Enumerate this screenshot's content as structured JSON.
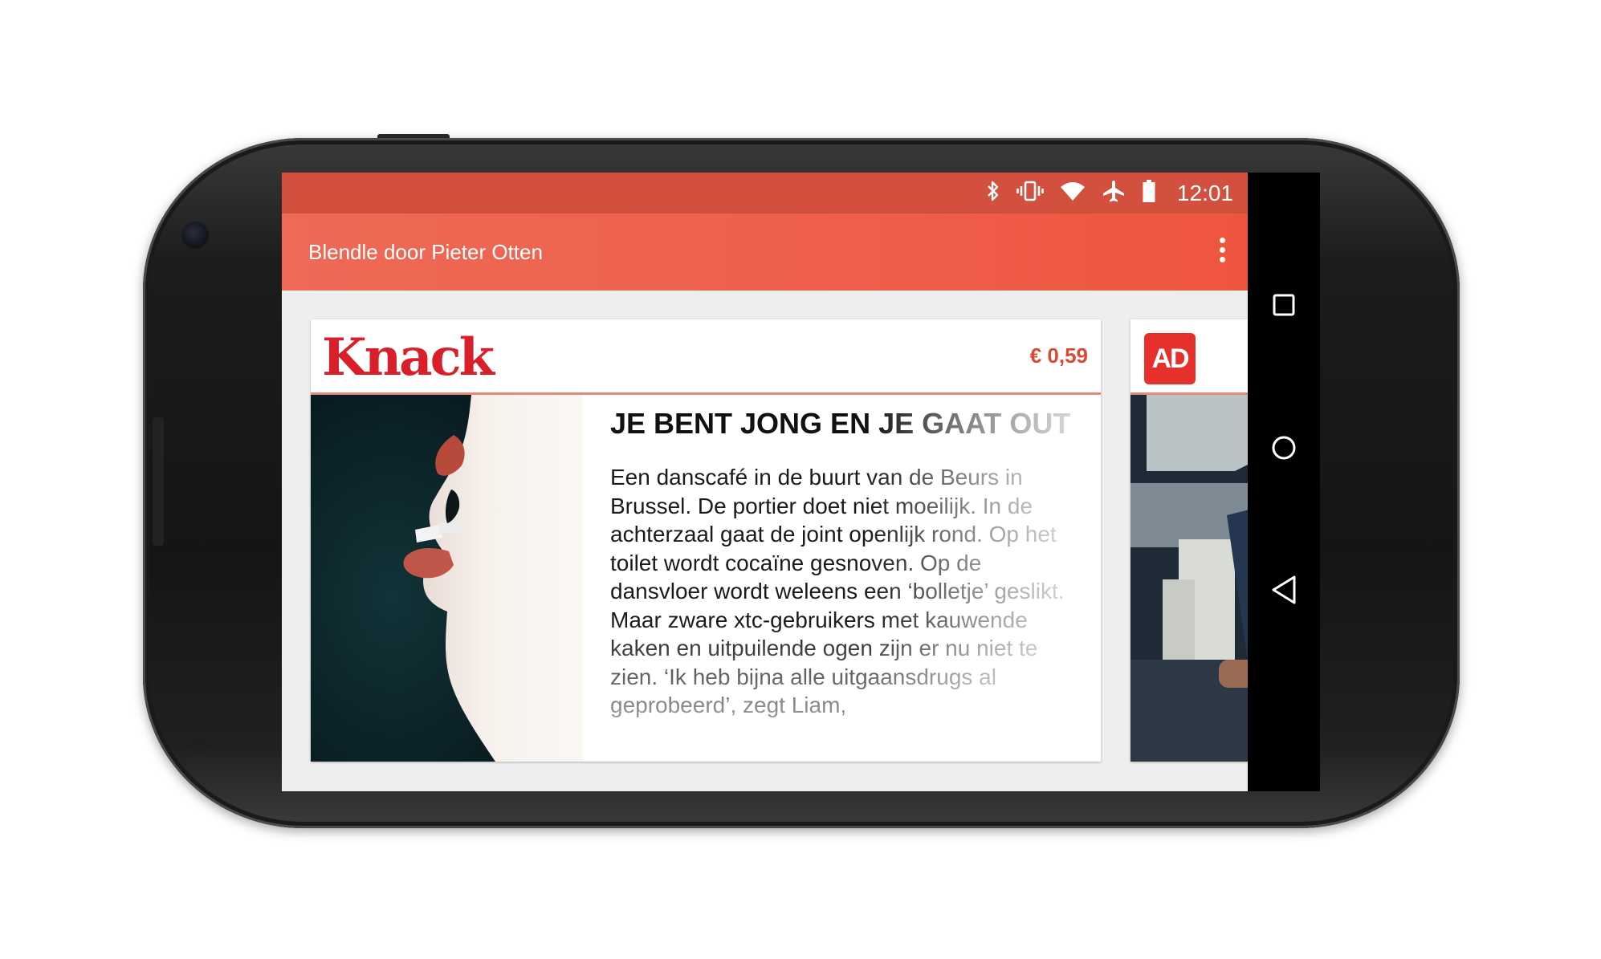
{
  "status_bar": {
    "time": "12:01",
    "icons": [
      "bluetooth-icon",
      "vibrate-icon",
      "wifi-icon",
      "airplane-icon",
      "battery-icon"
    ]
  },
  "app_bar": {
    "title": "Blendle door Pieter Otten",
    "menu_icon": "overflow-menu-icon"
  },
  "article": {
    "publication": "Knack",
    "price": "€ 0,59",
    "headline": "JE BENT JONG EN JE GAAT OUT",
    "excerpt": "Een danscafé in de buurt van de Beurs in Brussel. De portier doet niet moeilijk. In de achterzaal gaat de joint openlijk rond. Op het toilet wordt cocaïne gesnoven. Op de dansvloer wordt weleens een ‘bolletje’ geslikt. Maar zware xtc-gebruikers met kauwende kaken en uitpuilende ogen zijn er nu niet te zien. ‘Ik heb bijna alle uitgaansdrugs al geprobeerd’, zegt Liam,"
  },
  "next_article": {
    "publication": "AD"
  },
  "nav_bar": {
    "buttons": [
      "recents-icon",
      "home-icon",
      "back-icon"
    ]
  },
  "colors": {
    "status_bar": "#d2503d",
    "app_bar": "#ef5f4b",
    "accent": "#d74b34",
    "knack_red": "#d81f2a",
    "ad_red": "#e5302b"
  }
}
